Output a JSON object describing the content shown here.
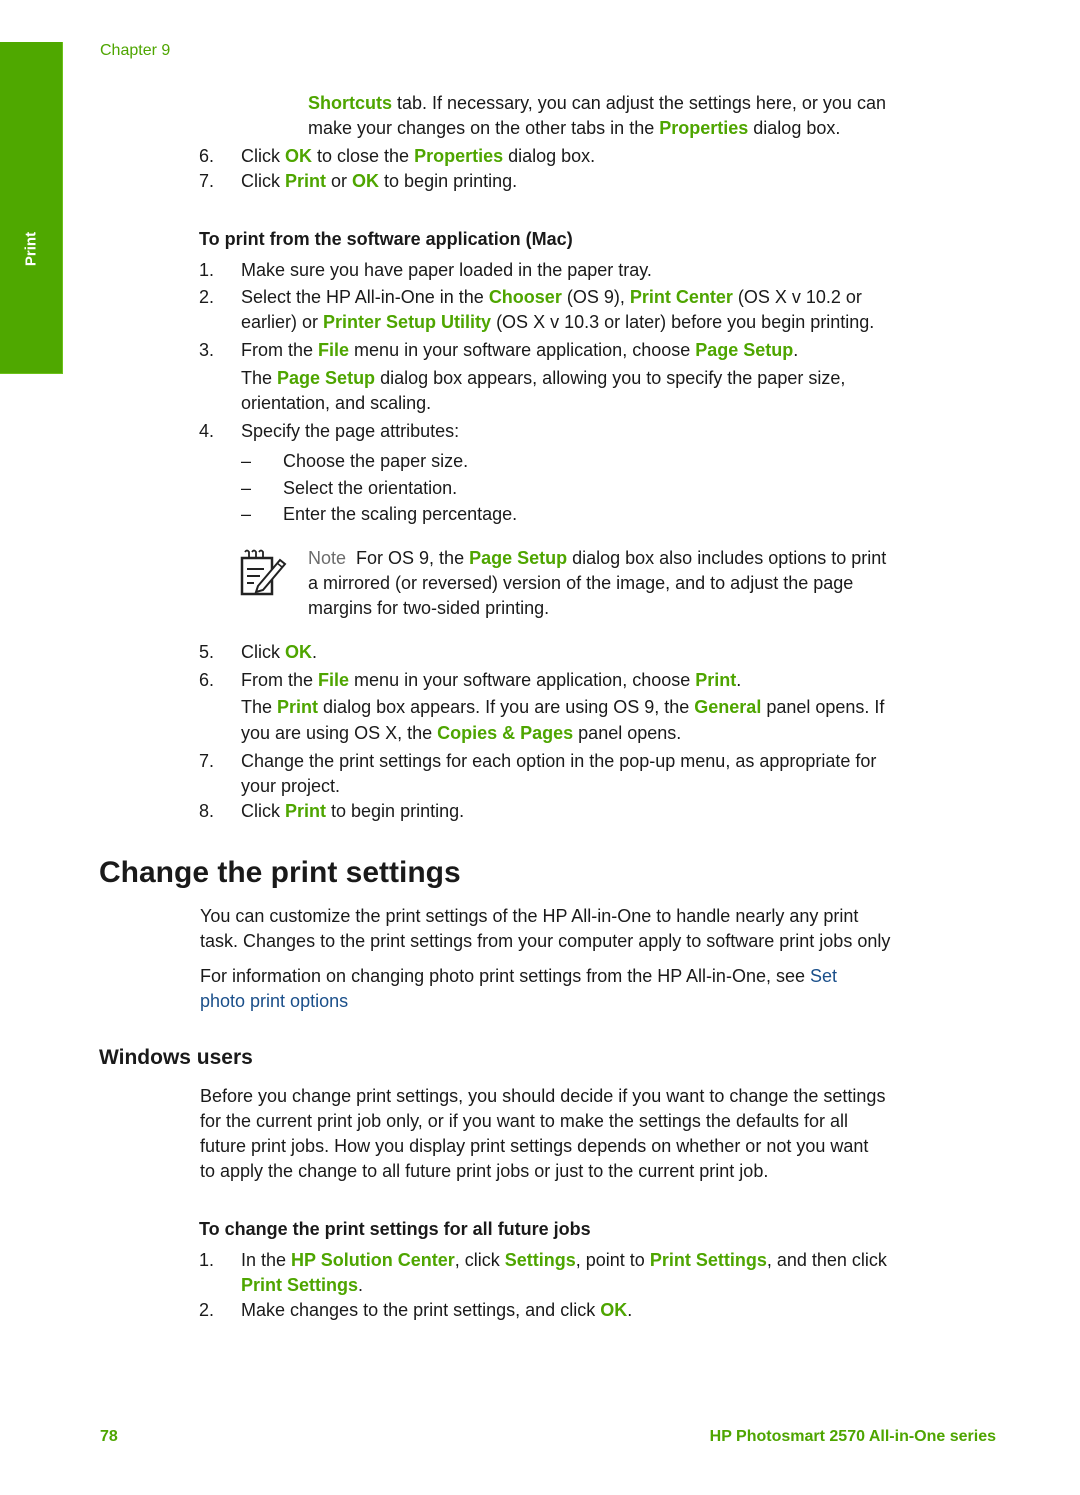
{
  "side_tab": {
    "label": "Print"
  },
  "header": {
    "chapter": "Chapter 9"
  },
  "top_section": {
    "continued_line1": {
      "link": "Shortcuts",
      "rest": " tab. If necessary, you can adjust the settings here, or you can"
    },
    "continued_line2": {
      "pre": "make your changes on the other tabs in the ",
      "link": "Properties",
      "post": " dialog box."
    },
    "step6": {
      "num": "6.",
      "pre": "Click ",
      "ok": "OK",
      "mid": " to close the ",
      "link": "Properties",
      "post": " dialog box."
    },
    "step7": {
      "num": "7.",
      "pre": "Click ",
      "print": "Print",
      "mid": " or ",
      "ok": "OK",
      "post": " to begin printing."
    }
  },
  "mac_section": {
    "heading": "To print from the software application (Mac)",
    "step1": {
      "num": "1.",
      "text": "Make sure you have paper loaded in the paper tray."
    },
    "step2": {
      "num": "2.",
      "line1_pre": "Select the HP All-in-One in the ",
      "chooser": "Chooser",
      "line1_mid": " (OS 9), ",
      "print_center": "Print Center",
      "line1_post": " (OS X v 10.2 or",
      "line2_pre": "earlier) or ",
      "utility": "Printer Setup Utility",
      "line2_post": " (OS X v 10.3 or later) before you begin printing."
    },
    "step3": {
      "num": "3.",
      "pre": "From the ",
      "file": "File",
      "mid": " menu in your software application, choose ",
      "page_setup": "Page Setup",
      "post": ".",
      "detail_pre": "The ",
      "detail_link": "Page Setup",
      "detail_post": " dialog box appears, allowing you to specify the paper size,",
      "detail_line2": "orientation, and scaling."
    },
    "step4": {
      "num": "4.",
      "text": "Specify the page attributes:",
      "bullets": [
        {
          "dash": "–",
          "text": "Choose the paper size."
        },
        {
          "dash": "–",
          "text": "Select the orientation."
        },
        {
          "dash": "–",
          "text": "Enter the scaling percentage."
        }
      ]
    },
    "note": {
      "label": "Note",
      "line1_pre": "  For OS 9, the ",
      "link": "Page Setup",
      "line1_post": " dialog box also includes options to print",
      "line2": "a mirrored (or reversed) version of the image, and to adjust the page",
      "line3": "margins for two-sided printing."
    },
    "step5": {
      "num": "5.",
      "pre": "Click ",
      "ok": "OK",
      "post": "."
    },
    "step6": {
      "num": "6.",
      "pre": "From the ",
      "file": "File",
      "mid": " menu in your software application, choose ",
      "print": "Print",
      "post": ".",
      "d1_pre": "The ",
      "d1_print": "Print",
      "d1_mid": " dialog box appears. If you are using OS 9, the ",
      "d1_general": "General",
      "d1_post": " panel opens. If",
      "d2_pre": "you are using OS X, the ",
      "d2_link": "Copies & Pages",
      "d2_post": " panel opens."
    },
    "step7": {
      "num": "7.",
      "line1": "Change the print settings for each option in the pop-up menu, as appropriate for",
      "line2": "your project."
    },
    "step8": {
      "num": "8.",
      "pre": "Click ",
      "print": "Print",
      "post": " to begin printing."
    }
  },
  "change_section": {
    "title": "Change the print settings",
    "p1_line1": "You can customize the print settings of the HP All-in-One to handle nearly any print",
    "p1_line2": "task. Changes to the print settings from your computer apply to software print jobs only",
    "p2_line1_pre": "For information on changing photo print settings from the HP All-in-One, see ",
    "p2_link_part1": "Set",
    "p2_link_part2": "photo print options"
  },
  "windows_section": {
    "title": "Windows users",
    "p_lines": [
      "Before you change print settings, you should decide if you want to change the settings",
      "for the current print job only, or if you want to make the settings the defaults for all",
      "future print jobs. How you display print settings depends on whether or not you want",
      "to apply the change to all future print jobs or just to the current print job."
    ],
    "subheading": "To change the print settings for all future jobs",
    "step1": {
      "num": "1.",
      "pre": "In the ",
      "hsc": "HP Solution Center",
      "mid1": ", click ",
      "settings": "Settings",
      "mid2": ", point to ",
      "print_settings": "Print Settings",
      "post": ", and then click",
      "line2_link": "Print Settings",
      "line2_post": "."
    },
    "step2": {
      "num": "2.",
      "pre": "Make changes to the print settings, and click ",
      "ok": "OK",
      "post": "."
    }
  },
  "footer": {
    "page_number": "78",
    "product": "HP Photosmart 2570 All-in-One series"
  }
}
